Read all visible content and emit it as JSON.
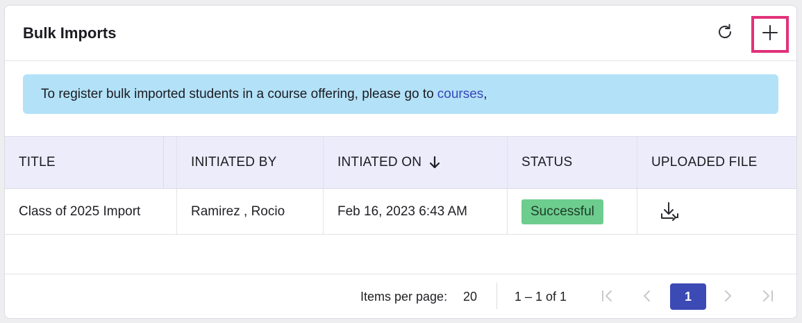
{
  "header": {
    "title": "Bulk Imports",
    "refresh_icon": "refresh-icon",
    "add_icon": "plus-icon"
  },
  "banner": {
    "text": "To register bulk imported students in a course offering, please go to ",
    "link_text": "courses",
    "suffix": ","
  },
  "table": {
    "columns": [
      "TITLE",
      "INITIATED BY",
      "INTIATED ON",
      "STATUS",
      "UPLOADED FILE"
    ],
    "sort_icon": "arrow-down-icon",
    "rows": [
      {
        "title": "Class of 2025 Import",
        "initiated_by": "Ramirez , Rocio",
        "initiated_on": "Feb 16, 2023 6:43 AM",
        "status": "Successful",
        "file_icon": "download-icon"
      }
    ]
  },
  "pagination": {
    "items_per_page_label": "Items per page:",
    "items_per_page": "20",
    "range": "1 – 1 of 1",
    "current_page": "1"
  },
  "colors": {
    "accent": "#3c4ab5",
    "highlight": "#e0327a",
    "banner_bg": "#b3e2f8",
    "header_bg": "#ececfb",
    "success": "#6dcd8e"
  }
}
